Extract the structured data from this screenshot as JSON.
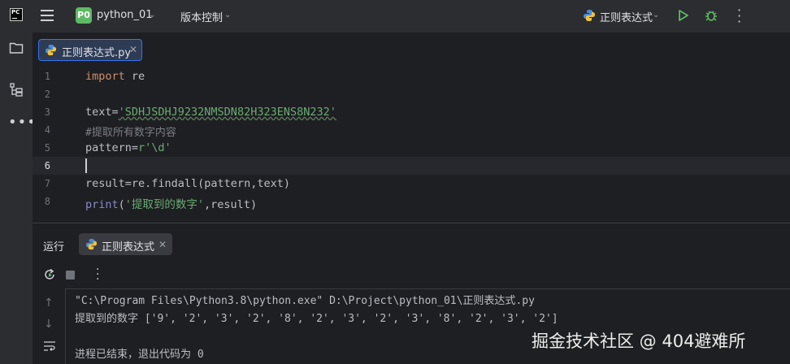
{
  "titlebar": {
    "logo_text": "PC",
    "project_badge": "P0",
    "project_name": "python_01",
    "vcs_label": "版本控制",
    "run_config": "正则表达式"
  },
  "editor": {
    "tab_label": "正则表达式.py",
    "line_numbers": [
      "1",
      "2",
      "3",
      "4",
      "5",
      "6",
      "7",
      "8"
    ],
    "lines": {
      "l1_kw": "import",
      "l1_rest": " re",
      "l3_var": "text=",
      "l3_str": "'SDHJSDHJ9232NMSDN82H323ENS8N232'",
      "l4_comment": "#提取所有数字内容",
      "l5_var": "pattern=",
      "l5_str": "r'\\d'",
      "l7": "result=re.findall(pattern,text)",
      "l8_fn": "print",
      "l8_open": "(",
      "l8_str": "'提取到的数字'",
      "l8_rest": ",result)"
    }
  },
  "run_panel": {
    "title": "运行",
    "tab_label": "正则表达式",
    "console": [
      "\"C:\\Program Files\\Python3.8\\python.exe\" D:\\Project\\python_01\\正则表达式.py",
      "提取到的数字 ['9', '2', '3', '2', '8', '2', '3', '2', '3', '8', '2', '3', '2']",
      "进程已结束，退出代码为 0"
    ]
  },
  "watermark": "掘金技术社区 @ 404避难所",
  "colors": {
    "accent": "#3574f0",
    "run_green": "#5fb865",
    "keyword": "#cf8e6d",
    "string": "#6aab73"
  },
  "icons": [
    "pycharm-logo-icon",
    "menu-icon",
    "folder-icon",
    "structure-icon",
    "more-icon",
    "python-file-icon",
    "run-icon",
    "debug-icon",
    "rerun-icon",
    "stop-icon",
    "scroll-up-icon",
    "scroll-down-icon",
    "soft-wrap-icon"
  ]
}
